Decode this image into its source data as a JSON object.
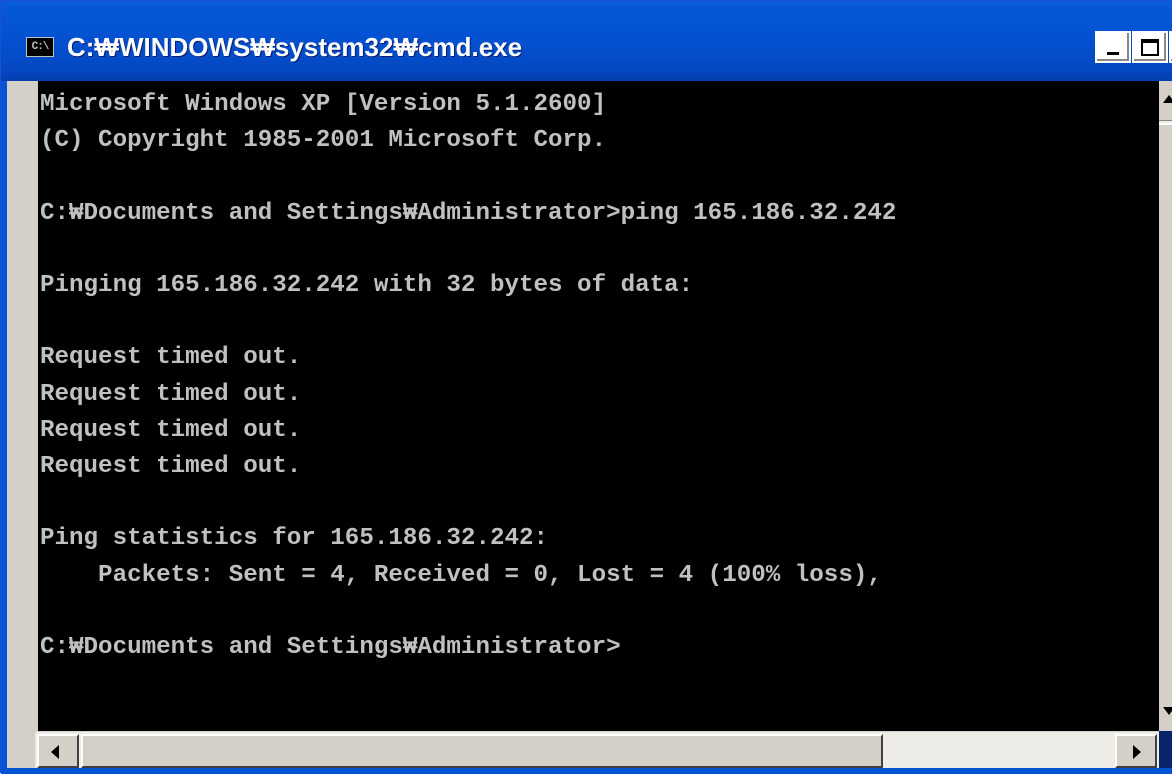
{
  "window": {
    "title": "C:₩WINDOWS₩system32₩cmd.exe",
    "icon_text": "C:\\"
  },
  "console": {
    "lines": [
      "Microsoft Windows XP [Version 5.1.2600]",
      "(C) Copyright 1985-2001 Microsoft Corp.",
      "",
      "C:₩Documents and Settings₩Administrator>ping 165.186.32.242",
      "",
      "Pinging 165.186.32.242 with 32 bytes of data:",
      "",
      "Request timed out.",
      "Request timed out.",
      "Request timed out.",
      "Request timed out.",
      "",
      "Ping statistics for 165.186.32.242:",
      "    Packets: Sent = 4, Received = 0, Lost = 4 (100% loss),",
      "",
      "C:₩Documents and Settings₩Administrator>"
    ]
  },
  "colors": {
    "titlebar": "#0453d3",
    "console_bg": "#000000",
    "console_text": "#c0c0c0"
  }
}
